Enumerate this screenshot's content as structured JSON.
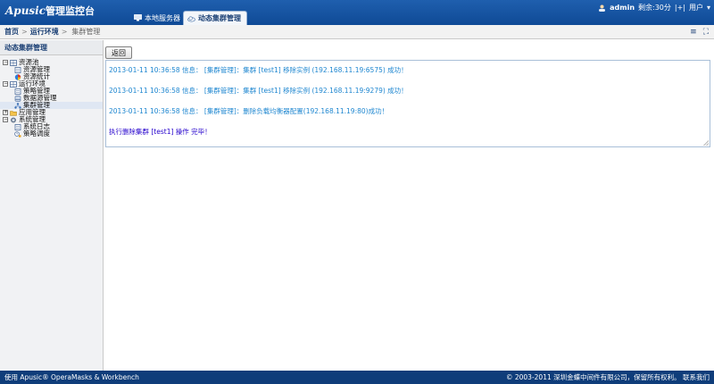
{
  "header": {
    "brand": "Apusic",
    "title_cn": "管理监控台",
    "tabs": [
      {
        "label": "本地服务器",
        "icon": "monitor-icon",
        "active": false
      },
      {
        "label": "动态集群管理",
        "icon": "cloud-icon",
        "active": true
      }
    ],
    "user_name": "admin",
    "session_left": "剩余:30分",
    "separator": "|+|",
    "user_menu": "用户"
  },
  "breadcrumb": {
    "items": [
      "首页",
      "运行环境",
      "集群管理"
    ],
    "sep": ">"
  },
  "sidebar": {
    "title": "动态集群管理",
    "tree": [
      {
        "label": "资源池",
        "level": 0,
        "toggle": "-",
        "icon": "grid-icon"
      },
      {
        "label": "资源管理",
        "level": 1,
        "icon": "document-icon"
      },
      {
        "label": "资源统计",
        "level": 1,
        "icon": "pie-chart-icon"
      },
      {
        "label": "运行环境",
        "level": 0,
        "toggle": "-",
        "icon": "grid-icon"
      },
      {
        "label": "策略管理",
        "level": 1,
        "icon": "document-icon"
      },
      {
        "label": "数据源管理",
        "level": 1,
        "icon": "database-icon"
      },
      {
        "label": "集群管理",
        "level": 1,
        "icon": "cluster-icon",
        "selected": true
      },
      {
        "label": "应用管理",
        "level": 0,
        "toggle": "+",
        "icon": "folder-icon"
      },
      {
        "label": "系统管理",
        "level": 0,
        "toggle": "-",
        "icon": "gear-icon"
      },
      {
        "label": "系统日志",
        "level": 1,
        "icon": "document-icon"
      },
      {
        "label": "策略调度",
        "level": 1,
        "icon": "schedule-icon"
      }
    ]
  },
  "main": {
    "back_label": "返回",
    "logs": [
      "2013-01-11 10:36:58 信息： [集群管理]：集群 [test1] 移除实例 (192.168.11.19:6575) 成功！",
      "2013-01-11 10:36:58 信息： [集群管理]：集群 [test1] 移除实例 (192.168.11.19:9279) 成功！",
      "2013-01-11 10:36:58 信息： [集群管理]：删除负载均衡器配置(192.168.11.19:80)成功！"
    ],
    "completion": "执行删除集群 [test1] 操作 完毕！"
  },
  "footer": {
    "left": "使用 Apusic® OperaMasks & Workbench",
    "right": "© 2003-2011 深圳金蝶中间件有限公司，保留所有权利。 联系我们"
  },
  "colors": {
    "header": "#1f5fae",
    "footer": "#0f3d7a",
    "log_text": "#1f87d0",
    "done_text": "#2400cc"
  }
}
